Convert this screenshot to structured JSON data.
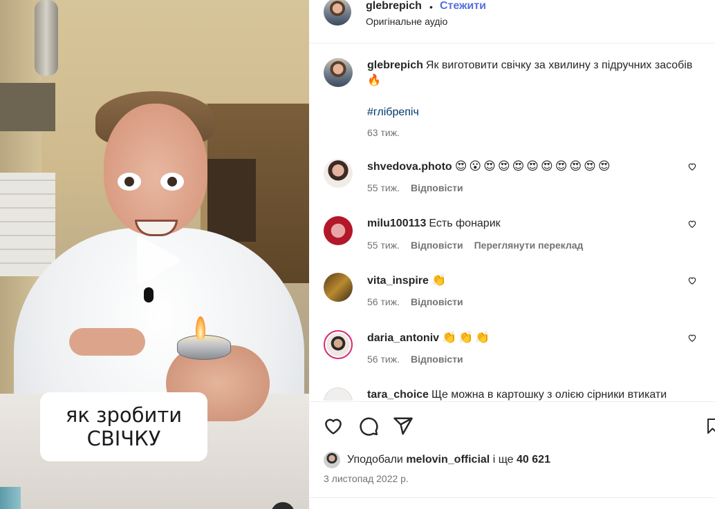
{
  "video": {
    "overlay_line1": "як зробити",
    "overlay_line2": "СВІЧКУ",
    "play_icon": "play-icon"
  },
  "header": {
    "username": "glebrepich",
    "separator": "•",
    "follow_label": "Стежити",
    "audio_label": "Оригінальне аудіо"
  },
  "caption": {
    "username": "glebrepich",
    "text": "Як виготовити свічку за хвилину з підручних засобів 🔥",
    "hashtag": "#глібрепіч",
    "time": "63 тиж."
  },
  "comments": [
    {
      "username": "shvedova.photo",
      "text": "😍😮😍😍😍😍😍😍😍😍😍",
      "time": "55 тиж.",
      "reply": "Відповісти",
      "translate": ""
    },
    {
      "username": "milu100113",
      "text": "Есть фонарик",
      "time": "55 тиж.",
      "reply": "Відповісти",
      "translate": "Переглянути переклад"
    },
    {
      "username": "vita_inspire",
      "text": "👏",
      "time": "56 тиж.",
      "reply": "Відповісти",
      "translate": ""
    },
    {
      "username": "daria_antoniv",
      "text": "👏👏👏",
      "time": "56 тиж.",
      "reply": "Відповісти",
      "translate": ""
    },
    {
      "username": "tara_choice",
      "text": "Ще можна в картошку з олією сірники втикати",
      "time": "",
      "reply": "",
      "translate": ""
    }
  ],
  "actions": {
    "like_icon": "heart-icon",
    "comment_icon": "comment-icon",
    "share_icon": "share-icon",
    "save_icon": "bookmark-icon",
    "liked_by_prefix": "Уподобали",
    "liked_by_user": "melovin_official",
    "liked_by_and": "і ще",
    "liked_by_count": "40 621",
    "date": "3 листопад 2022 р."
  },
  "colors": {
    "link_blue": "#5470e0",
    "hashtag_blue": "#00376b",
    "secondary_text": "#737373"
  }
}
